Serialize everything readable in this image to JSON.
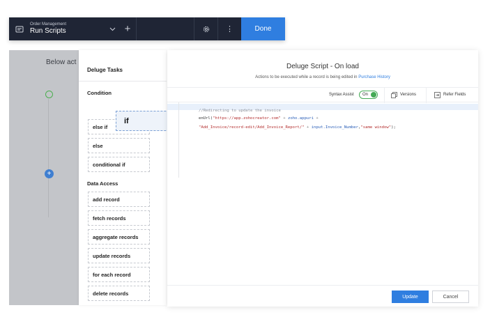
{
  "header": {
    "breadcrumb": "Order Management",
    "title": "Run Scripts",
    "add_label": "+",
    "more_label": "⋮",
    "done_label": "Done"
  },
  "canvas": {
    "below_text": "Below act"
  },
  "tasks": {
    "title": "Deluge Tasks",
    "sections": {
      "condition": "Condition",
      "data_access": "Data Access"
    },
    "condition_items": [
      "else if",
      "else",
      "conditional if"
    ],
    "data_access_items": [
      "add record",
      "fetch records",
      "aggregate records",
      "update records",
      "for each record",
      "delete records"
    ],
    "dragged_item": "if"
  },
  "editor": {
    "title": "Deluge Script - On load",
    "subtitle": "Actions to be executed while a record is being edited in",
    "subtitle_link": "Purchase History",
    "syntax_assist_label": "Syntax Assist",
    "syntax_assist_state": "On",
    "versions_label": "Versions",
    "refer_fields_label": "Refer Fields",
    "code": {
      "line1": "//Redirecting to update the invoice",
      "line2_a": "enUrl(",
      "line2_b": "\"https://app.zohocreator.com\"",
      "line2_c": " + ",
      "line2_d": "zoho.appuri",
      "line2_e": " +",
      "line3_a": "\"Add_Invoice/record-edit/Add_Invoice_Report/\"",
      "line3_b": " + ",
      "line3_c": "input.Invoice_Number",
      "line3_d": ",",
      "line3_e": "\"same window\"",
      "line3_f": ");"
    },
    "update_label": "Update",
    "cancel_label": "Cancel"
  },
  "colors": {
    "topbar": "#1f2535",
    "accent": "#2f7ee0",
    "toggle_on": "#44aa55"
  }
}
